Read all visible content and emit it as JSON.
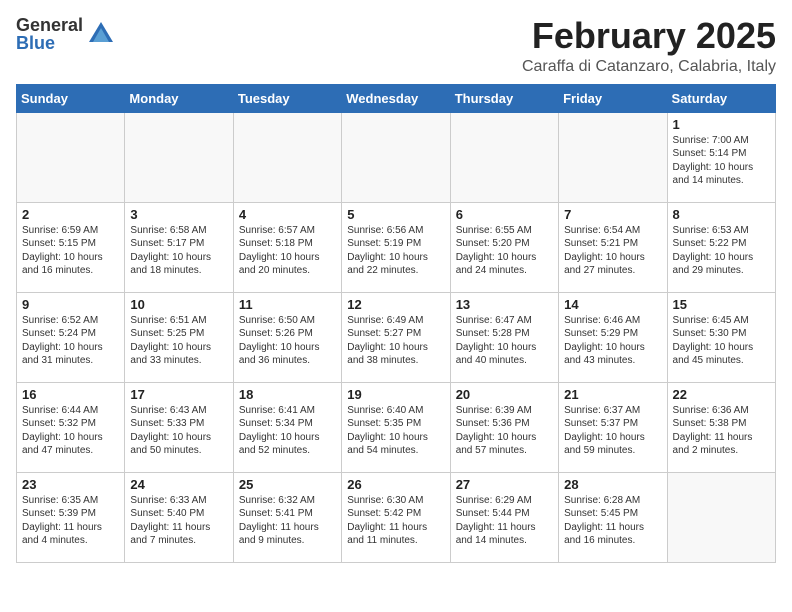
{
  "logo": {
    "general": "General",
    "blue": "Blue"
  },
  "title": {
    "month": "February 2025",
    "location": "Caraffa di Catanzaro, Calabria, Italy"
  },
  "weekdays": [
    "Sunday",
    "Monday",
    "Tuesday",
    "Wednesday",
    "Thursday",
    "Friday",
    "Saturday"
  ],
  "weeks": [
    [
      {
        "day": "",
        "info": ""
      },
      {
        "day": "",
        "info": ""
      },
      {
        "day": "",
        "info": ""
      },
      {
        "day": "",
        "info": ""
      },
      {
        "day": "",
        "info": ""
      },
      {
        "day": "",
        "info": ""
      },
      {
        "day": "1",
        "info": "Sunrise: 7:00 AM\nSunset: 5:14 PM\nDaylight: 10 hours\nand 14 minutes."
      }
    ],
    [
      {
        "day": "2",
        "info": "Sunrise: 6:59 AM\nSunset: 5:15 PM\nDaylight: 10 hours\nand 16 minutes."
      },
      {
        "day": "3",
        "info": "Sunrise: 6:58 AM\nSunset: 5:17 PM\nDaylight: 10 hours\nand 18 minutes."
      },
      {
        "day": "4",
        "info": "Sunrise: 6:57 AM\nSunset: 5:18 PM\nDaylight: 10 hours\nand 20 minutes."
      },
      {
        "day": "5",
        "info": "Sunrise: 6:56 AM\nSunset: 5:19 PM\nDaylight: 10 hours\nand 22 minutes."
      },
      {
        "day": "6",
        "info": "Sunrise: 6:55 AM\nSunset: 5:20 PM\nDaylight: 10 hours\nand 24 minutes."
      },
      {
        "day": "7",
        "info": "Sunrise: 6:54 AM\nSunset: 5:21 PM\nDaylight: 10 hours\nand 27 minutes."
      },
      {
        "day": "8",
        "info": "Sunrise: 6:53 AM\nSunset: 5:22 PM\nDaylight: 10 hours\nand 29 minutes."
      }
    ],
    [
      {
        "day": "9",
        "info": "Sunrise: 6:52 AM\nSunset: 5:24 PM\nDaylight: 10 hours\nand 31 minutes."
      },
      {
        "day": "10",
        "info": "Sunrise: 6:51 AM\nSunset: 5:25 PM\nDaylight: 10 hours\nand 33 minutes."
      },
      {
        "day": "11",
        "info": "Sunrise: 6:50 AM\nSunset: 5:26 PM\nDaylight: 10 hours\nand 36 minutes."
      },
      {
        "day": "12",
        "info": "Sunrise: 6:49 AM\nSunset: 5:27 PM\nDaylight: 10 hours\nand 38 minutes."
      },
      {
        "day": "13",
        "info": "Sunrise: 6:47 AM\nSunset: 5:28 PM\nDaylight: 10 hours\nand 40 minutes."
      },
      {
        "day": "14",
        "info": "Sunrise: 6:46 AM\nSunset: 5:29 PM\nDaylight: 10 hours\nand 43 minutes."
      },
      {
        "day": "15",
        "info": "Sunrise: 6:45 AM\nSunset: 5:30 PM\nDaylight: 10 hours\nand 45 minutes."
      }
    ],
    [
      {
        "day": "16",
        "info": "Sunrise: 6:44 AM\nSunset: 5:32 PM\nDaylight: 10 hours\nand 47 minutes."
      },
      {
        "day": "17",
        "info": "Sunrise: 6:43 AM\nSunset: 5:33 PM\nDaylight: 10 hours\nand 50 minutes."
      },
      {
        "day": "18",
        "info": "Sunrise: 6:41 AM\nSunset: 5:34 PM\nDaylight: 10 hours\nand 52 minutes."
      },
      {
        "day": "19",
        "info": "Sunrise: 6:40 AM\nSunset: 5:35 PM\nDaylight: 10 hours\nand 54 minutes."
      },
      {
        "day": "20",
        "info": "Sunrise: 6:39 AM\nSunset: 5:36 PM\nDaylight: 10 hours\nand 57 minutes."
      },
      {
        "day": "21",
        "info": "Sunrise: 6:37 AM\nSunset: 5:37 PM\nDaylight: 10 hours\nand 59 minutes."
      },
      {
        "day": "22",
        "info": "Sunrise: 6:36 AM\nSunset: 5:38 PM\nDaylight: 11 hours\nand 2 minutes."
      }
    ],
    [
      {
        "day": "23",
        "info": "Sunrise: 6:35 AM\nSunset: 5:39 PM\nDaylight: 11 hours\nand 4 minutes."
      },
      {
        "day": "24",
        "info": "Sunrise: 6:33 AM\nSunset: 5:40 PM\nDaylight: 11 hours\nand 7 minutes."
      },
      {
        "day": "25",
        "info": "Sunrise: 6:32 AM\nSunset: 5:41 PM\nDaylight: 11 hours\nand 9 minutes."
      },
      {
        "day": "26",
        "info": "Sunrise: 6:30 AM\nSunset: 5:42 PM\nDaylight: 11 hours\nand 11 minutes."
      },
      {
        "day": "27",
        "info": "Sunrise: 6:29 AM\nSunset: 5:44 PM\nDaylight: 11 hours\nand 14 minutes."
      },
      {
        "day": "28",
        "info": "Sunrise: 6:28 AM\nSunset: 5:45 PM\nDaylight: 11 hours\nand 16 minutes."
      },
      {
        "day": "",
        "info": ""
      }
    ]
  ]
}
